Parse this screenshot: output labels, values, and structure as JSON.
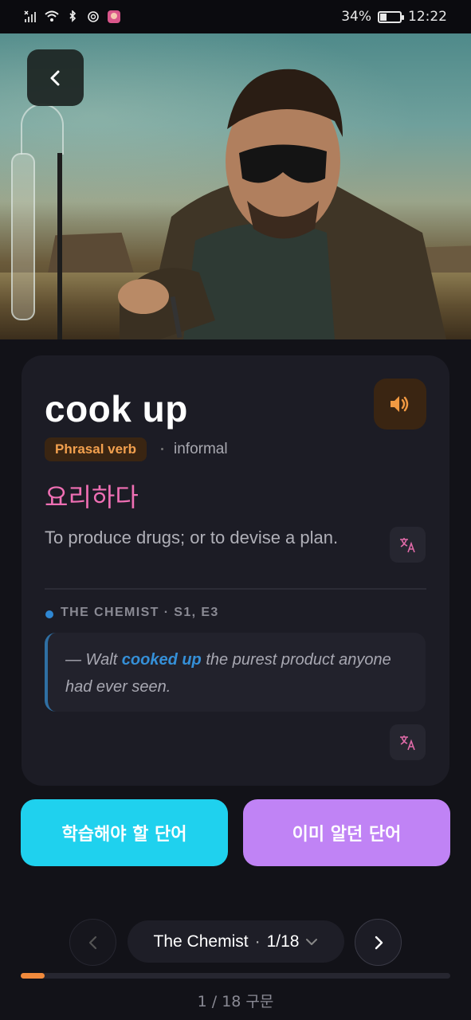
{
  "status_bar": {
    "battery_percent": "34%",
    "battery_level": 0.34,
    "time": "12:22",
    "icons": [
      "no-sim-signal-icon",
      "wifi-icon",
      "bluetooth-icon",
      "openai-icon",
      "app-avatar-icon"
    ]
  },
  "hero": {
    "image": "man-in-sunglasses-with-lab-glassware-in-desert",
    "back_icon": "chevron-left-icon"
  },
  "card": {
    "word": "cook up",
    "part_of_speech": "Phrasal verb",
    "register": "informal",
    "meaning_ko": "요리하다",
    "definition": "To produce drugs; or to devise a plan.",
    "audio_icon": "speaker-icon",
    "translate_icon": "translate-icon",
    "source": "THE CHEMIST · S1, E3",
    "quote": {
      "before": "— Walt ",
      "highlight": "cooked up",
      "after": " the purest product anyone had ever seen."
    }
  },
  "actions": {
    "learn_label": "학습해야 할 단어",
    "known_label": "이미 알던 단어"
  },
  "pager": {
    "deck": "The Chemist",
    "separator": "·",
    "position": "1/18",
    "progress": 0.0556,
    "count_label": "1 / 18 구문"
  },
  "colors": {
    "accent_orange": "#f08a3c",
    "meaning_pink": "#ef6fb4",
    "learn_cyan": "#1fd1ee",
    "known_purple": "#c083f5",
    "highlight_blue": "#3590d8"
  }
}
